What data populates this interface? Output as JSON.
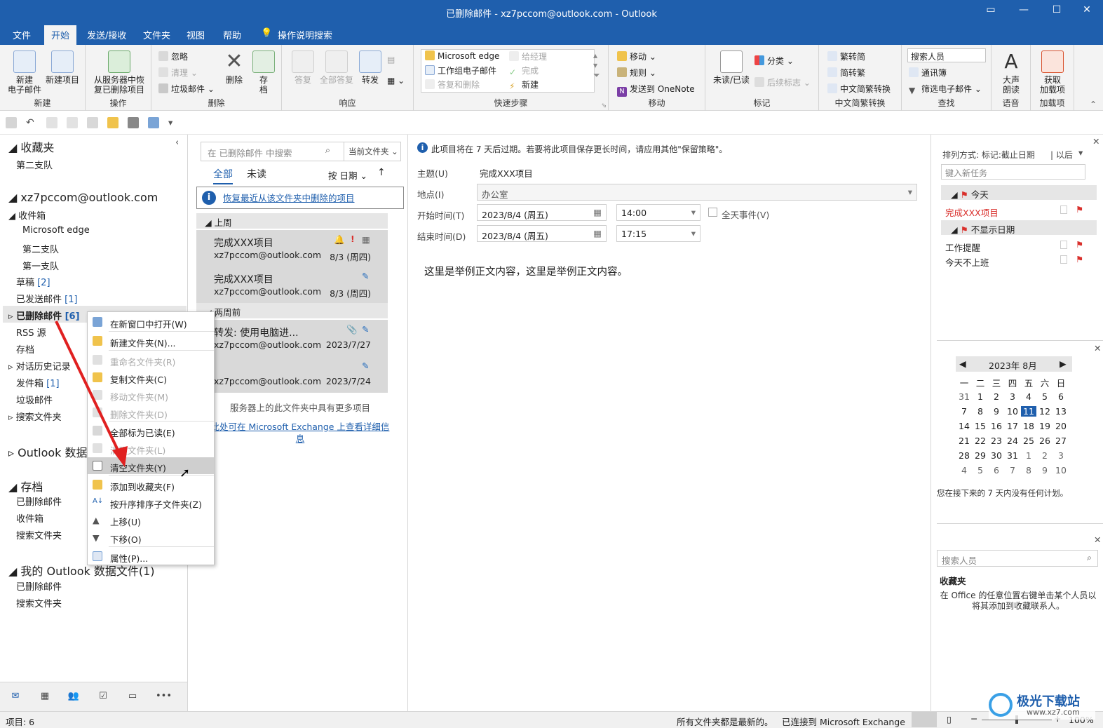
{
  "window": {
    "title": "已删除邮件 - xz7pccom@outlook.com  -  Outlook"
  },
  "menu": {
    "tabs": [
      "文件",
      "开始",
      "发送/接收",
      "文件夹",
      "视图",
      "帮助"
    ],
    "search": "操作说明搜索"
  },
  "ribbon": {
    "new_group": {
      "label": "新建",
      "new_mail": "新建\n电子邮件",
      "new_items": "新建项目"
    },
    "action_group": {
      "label": "操作",
      "recover": "从服务器中恢\n复已删除项目"
    },
    "delete_group": {
      "label": "删除",
      "ignore": "忽略",
      "clean": "清理",
      "junk": "垃圾邮件",
      "delete": "删除",
      "archive": "存\n档"
    },
    "respond_group": {
      "label": "响应",
      "reply": "答复",
      "reply_all": "全部答复",
      "forward": "转发"
    },
    "quicksteps_group": {
      "label": "快速步骤",
      "items": [
        "Microsoft edge",
        "工作组电子邮件",
        "答复和删除",
        "给经理",
        "完成",
        "新建"
      ]
    },
    "move_group": {
      "label": "移动",
      "move": "移动",
      "rules": "规则",
      "onenote": "发送到 OneNote"
    },
    "tags_group": {
      "label": "标记",
      "unread": "未读/已读",
      "categorize": "分类",
      "followup": "后续标志"
    },
    "chinese_group": {
      "label": "中文简繁转换",
      "t2s": "繁转简",
      "s2t": "简转繁",
      "convert": "中文简繁转换"
    },
    "find_group": {
      "label": "查找",
      "search_people": "搜索人员",
      "address_book": "通讯簿",
      "filter": "筛选电子邮件"
    },
    "speech_group": {
      "label": "语音",
      "read_aloud": "大声\n朗读"
    },
    "addins_group": {
      "label": "加载项",
      "get_addins": "获取\n加载项"
    }
  },
  "folders": {
    "favorites": "收藏夹",
    "fav_item": "第二支队",
    "account": "xz7pccom@outlook.com",
    "inbox": "收件箱",
    "inbox_sub": [
      "Microsoft edge",
      "第二支队",
      "第一支队"
    ],
    "drafts": "草稿",
    "drafts_count": "[2]",
    "sent": "已发送邮件",
    "sent_count": "[1]",
    "deleted": "已删除邮件",
    "deleted_count": "[6]",
    "rss": "RSS 源",
    "archive": "存档",
    "history": "对话历史记录",
    "outbox": "发件箱",
    "outbox_count": "[1]",
    "junk": "垃圾邮件",
    "search": "搜索文件夹",
    "outlook_data": "Outlook 数据",
    "archive_section": "存档",
    "archive_items": [
      "已删除邮件",
      "收件箱",
      "搜索文件夹"
    ],
    "my_data": "我的 Outlook 数据文件(1)",
    "my_data_items": [
      "已删除邮件",
      "搜索文件夹"
    ]
  },
  "list": {
    "search_placeholder": "在 已删除邮件 中搜索",
    "scope": "当前文件夹",
    "tab_all": "全部",
    "tab_unread": "未读",
    "sort": "按 日期",
    "recover_link": "恢复最近从该文件夹中删除的项目",
    "group1": "上周",
    "group2": "两周前",
    "messages": [
      {
        "subject": "完成XXX项目",
        "from": "xz7pccom@outlook.com",
        "date": "8/3 (周四)"
      },
      {
        "subject": "完成XXX项目",
        "from": "xz7pccom@outlook.com",
        "date": "8/3 (周四)"
      },
      {
        "subject": "转发:    使用电脑进...",
        "from": "xz7pccom@outlook.com",
        "date": "2023/7/27"
      },
      {
        "subject": "",
        "from": "xz7pccom@outlook.com",
        "date": "2023/7/24"
      }
    ],
    "more_note": "服务器上的此文件夹中具有更多项目",
    "exchange_link": "此处可在 Microsoft Exchange 上查看详细信息"
  },
  "reading": {
    "info": "此项目将在 7 天后过期。若要将此项目保存更长时间，请应用其他\"保留策略\"。",
    "subject_label": "主题(U)",
    "subject": "完成XXX项目",
    "location_label": "地点(I)",
    "location": "办公室",
    "start_label": "开始时间(T)",
    "start_date": "2023/8/4 (周五)",
    "start_time": "14:00",
    "allday": "全天事件(V)",
    "end_label": "结束时间(D)",
    "end_date": "2023/8/4 (周五)",
    "end_time": "17:15",
    "body": "这里是举例正文内容，这里是举例正文内容。"
  },
  "todo": {
    "sort": "排列方式: 标记:截止日期",
    "later": "以后",
    "new_task": "键入新任务",
    "today": "今天",
    "task_today": "完成XXX项目",
    "no_date": "不显示日期",
    "tasks": [
      "工作提醒",
      "今天不上班"
    ],
    "month": "2023年 8月",
    "weekdays": [
      "一",
      "二",
      "三",
      "四",
      "五",
      "六",
      "日"
    ],
    "days": [
      "31",
      "1",
      "2",
      "3",
      "4",
      "5",
      "6",
      "7",
      "8",
      "9",
      "10",
      "11",
      "12",
      "13",
      "14",
      "15",
      "16",
      "17",
      "18",
      "19",
      "20",
      "21",
      "22",
      "23",
      "24",
      "25",
      "26",
      "27",
      "28",
      "29",
      "30",
      "31",
      "1",
      "2",
      "3",
      "4",
      "5",
      "6",
      "7",
      "8",
      "9",
      "10"
    ],
    "today_day": "11",
    "no_plan": "您在接下来的 7 天内没有任何计划。",
    "people_search": "搜索人员",
    "favorites": "收藏夹",
    "fav_hint": "在 Office 的任意位置右键单击某个人员以将其添加到收藏联系人。"
  },
  "context_menu": [
    {
      "label": "在新窗口中打开(W)",
      "enabled": true
    },
    {
      "label": "新建文件夹(N)...",
      "enabled": true
    },
    {
      "label": "重命名文件夹(R)",
      "enabled": false
    },
    {
      "label": "复制文件夹(C)",
      "enabled": true
    },
    {
      "label": "移动文件夹(M)",
      "enabled": false
    },
    {
      "label": "删除文件夹(D)",
      "enabled": false
    },
    {
      "label": "全部标为已读(E)",
      "enabled": true
    },
    {
      "label": "清理文件夹(L)",
      "enabled": false
    },
    {
      "label": "清空文件夹(Y)",
      "enabled": true
    },
    {
      "label": "添加到收藏夹(F)",
      "enabled": true
    },
    {
      "label": "按升序排序子文件夹(Z)",
      "enabled": true
    },
    {
      "label": "上移(U)",
      "enabled": true
    },
    {
      "label": "下移(O)",
      "enabled": true
    },
    {
      "label": "属性(P)...",
      "enabled": true
    }
  ],
  "status": {
    "items": "项目: 6",
    "uptodate": "所有文件夹都是最新的。",
    "connected": "已连接到 Microsoft Exchange",
    "zoom": "100%",
    "watermark": "极光下载站",
    "watermark_url": "www.xz7.com"
  },
  "colors": {
    "accent": "#1f5fad",
    "flag": "#d9302c",
    "selected": "#d9d9d9"
  }
}
